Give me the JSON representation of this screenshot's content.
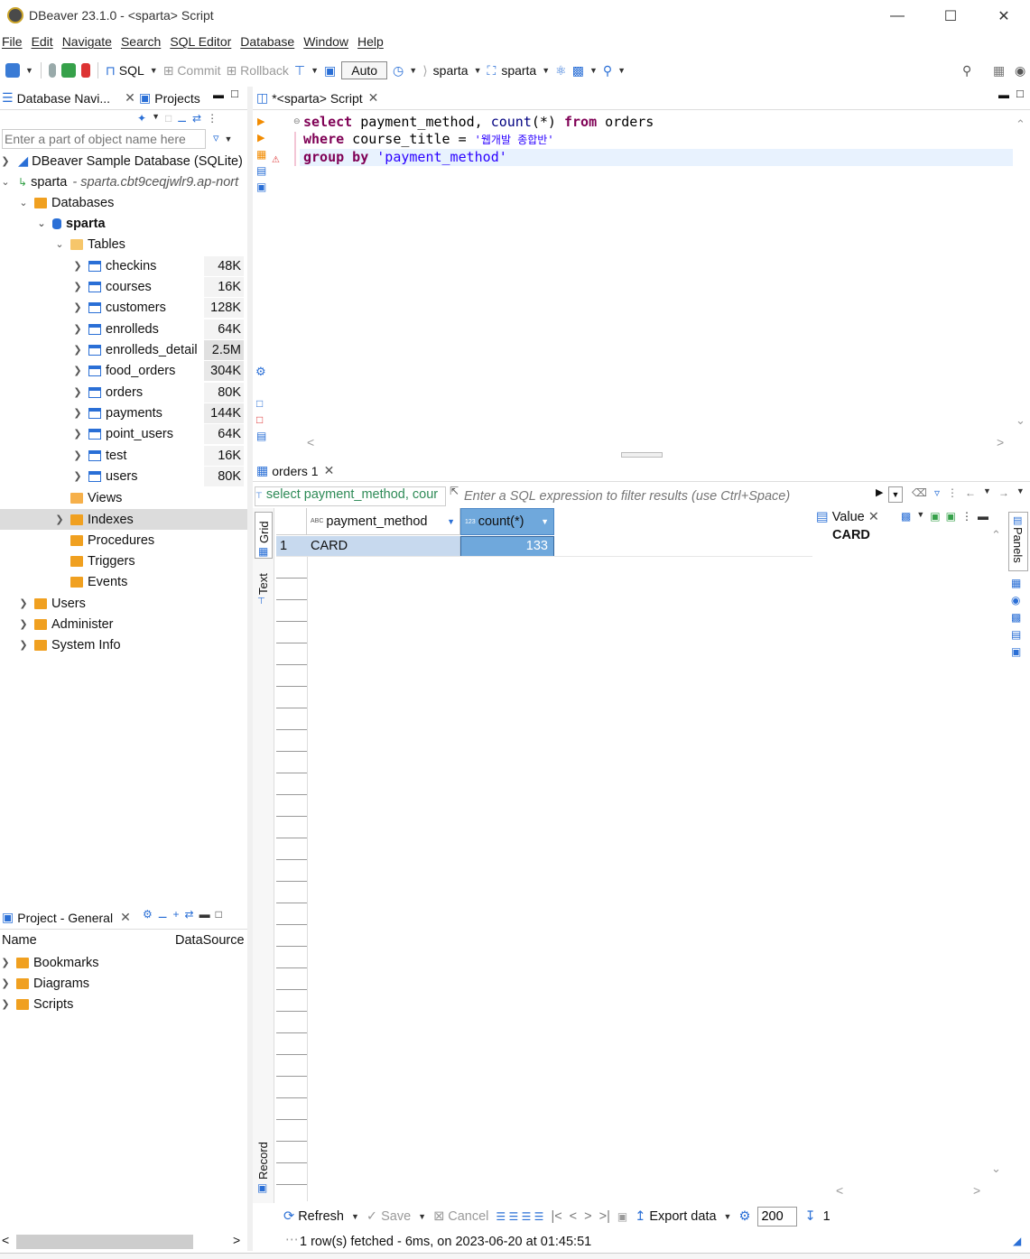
{
  "window": {
    "title": "DBeaver 23.1.0 - <sparta> Script"
  },
  "menu": [
    "File",
    "Edit",
    "Navigate",
    "Search",
    "SQL Editor",
    "Database",
    "Window",
    "Help"
  ],
  "toolbar": {
    "sql_label": "SQL",
    "commit_label": "Commit",
    "rollback_label": "Rollback",
    "auto_label": "Auto",
    "datasource": "sparta",
    "schema": "sparta"
  },
  "navigator": {
    "tab_db": "Database Navi...",
    "tab_projects": "Projects",
    "filter_placeholder": "Enter a part of object name here",
    "tree": {
      "sample_db": "DBeaver Sample Database (SQLite)",
      "sparta": "sparta",
      "sparta_host": "- sparta.cbt9ceqjwlr9.ap-nort",
      "databases": "Databases",
      "schema": "sparta",
      "tables": "Tables",
      "table_items": [
        {
          "name": "checkins",
          "size": "48K"
        },
        {
          "name": "courses",
          "size": "16K"
        },
        {
          "name": "customers",
          "size": "128K"
        },
        {
          "name": "enrolleds",
          "size": "64K"
        },
        {
          "name": "enrolleds_detail",
          "size": "2.5M"
        },
        {
          "name": "food_orders",
          "size": "304K"
        },
        {
          "name": "orders",
          "size": "80K"
        },
        {
          "name": "payments",
          "size": "144K"
        },
        {
          "name": "point_users",
          "size": "64K"
        },
        {
          "name": "test",
          "size": "16K"
        },
        {
          "name": "users",
          "size": "80K"
        }
      ],
      "views": "Views",
      "indexes": "Indexes",
      "procedures": "Procedures",
      "triggers": "Triggers",
      "events": "Events",
      "users": "Users",
      "administer": "Administer",
      "system_info": "System Info"
    }
  },
  "project": {
    "tab": "Project - General",
    "col_name": "Name",
    "col_ds": "DataSource",
    "items": [
      "Bookmarks",
      "Diagrams",
      "Scripts"
    ]
  },
  "editor": {
    "tab": "*<sparta> Script",
    "line1": {
      "k1": "select",
      "t1": " payment_method, ",
      "f1": "count",
      "t2": "(*) ",
      "k2": "from",
      "t3": " orders"
    },
    "line2": {
      "k1": "where",
      "t1": " course_title = ",
      "s1": "'웹개발 종합반'"
    },
    "line3": {
      "k1": "group by",
      "s1": " 'payment_method'"
    }
  },
  "results": {
    "tab": "orders 1",
    "query_preview": "select payment_method, cour",
    "filter_placeholder": "Enter a SQL expression to filter results (use Ctrl+Space)",
    "side_grid": "Grid",
    "side_text": "Text",
    "side_record": "Record",
    "columns": [
      "payment_method",
      "count(*)"
    ],
    "rows": [
      {
        "num": "1",
        "payment_method": "CARD",
        "count": "133"
      }
    ],
    "value_panel_title": "Value",
    "value_panel_content": "CARD",
    "panels_label": "Panels",
    "refresh": "Refresh",
    "save": "Save",
    "cancel": "Cancel",
    "export": "Export data",
    "limit": "200",
    "page_count": "1",
    "status": "1 row(s) fetched - 6ms, on 2023-06-20 at 01:45:51"
  }
}
